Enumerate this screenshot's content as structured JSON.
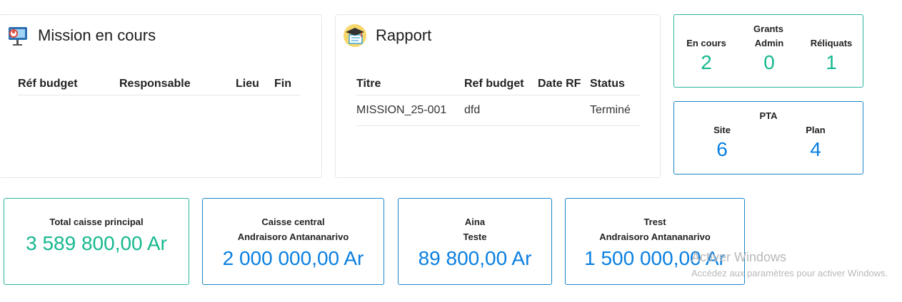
{
  "mission_panel": {
    "title": "Mission en cours",
    "icon": "presentation-icon",
    "columns": [
      "Réf budget",
      "Responsable",
      "Lieu",
      "Fin"
    ],
    "rows": []
  },
  "rapport_panel": {
    "title": "Rapport",
    "icon": "graduation-cap-icon",
    "columns": [
      "Titre",
      "Ref budget",
      "Date RF",
      "Status"
    ],
    "rows": [
      {
        "titre": "MISSION_25-001",
        "ref_budget": "dfd",
        "date_rf": "",
        "status": "Terminé"
      }
    ]
  },
  "grants": {
    "title": "Grants",
    "items": [
      {
        "label": "En cours",
        "value": "2"
      },
      {
        "label": "Admin",
        "value": "0"
      },
      {
        "label": "Réliquats",
        "value": "1"
      }
    ]
  },
  "pta": {
    "title": "PTA",
    "items": [
      {
        "label": "Site",
        "value": "6"
      },
      {
        "label": "Plan",
        "value": "4"
      }
    ]
  },
  "cash_boxes": [
    {
      "line1": "Total caisse principal",
      "line2": "",
      "amount": "3 589 800,00 Ar"
    },
    {
      "line1": "Caisse central",
      "line2": "Andraisoro Antananarivo",
      "amount": "2 000 000,00 Ar"
    },
    {
      "line1": "Aina",
      "line2": "Teste",
      "amount": "89 800,00 Ar"
    },
    {
      "line1": "Trest",
      "line2": "Andraisoro Antananarivo",
      "amount": "1 500 000,00 Ar"
    }
  ],
  "watermark": {
    "line1": "Activer Windows",
    "line2": "Accédez aux paramètres pour activer Windows."
  },
  "colors": {
    "green": "#17b890",
    "blue": "#0a7fe0",
    "teal_border": "#2bb5a0",
    "blue_border": "#1a86c8"
  }
}
